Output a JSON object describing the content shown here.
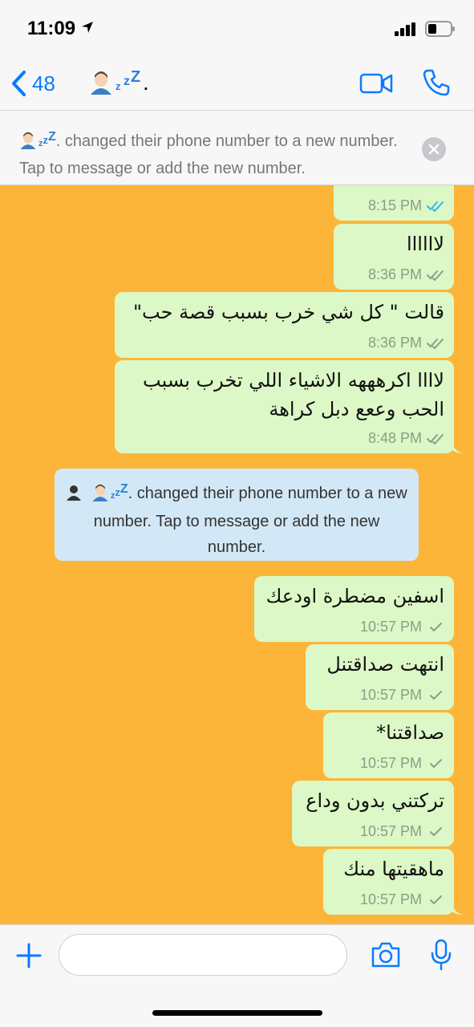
{
  "status_bar": {
    "time": "11:09"
  },
  "header": {
    "back_count": "48",
    "contact_suffix": ".",
    "zzz": [
      "z",
      "z",
      "Z"
    ]
  },
  "banner": {
    "text": ". changed their phone number to a new number. Tap to message or add the new number."
  },
  "messages": [
    {
      "text": "",
      "time": "8:15 PM",
      "status": "read"
    },
    {
      "text": "لاااااا",
      "time": "8:36 PM",
      "status": "delivered"
    },
    {
      "text": "قالت \" كل شي خرب بسبب قصة حب\"",
      "time": "8:36 PM",
      "status": "delivered"
    },
    {
      "line1": "لاااا اكرهههه الاشياء اللي تخرب بسبب",
      "line2": "الحب وععع دبل كراهة",
      "time": "8:48 PM",
      "status": "delivered"
    },
    {
      "text": "اسفين مضطرة اودعك",
      "time": "10:57 PM",
      "status": "sent"
    },
    {
      "text": "انتهت صداقتنل",
      "time": "10:57 PM",
      "status": "sent"
    },
    {
      "text": "صداقتنا*",
      "time": "10:57 PM",
      "status": "sent"
    },
    {
      "text": "تركتني بدون وداع",
      "time": "10:57 PM",
      "status": "sent"
    },
    {
      "text": "ماهقيتها منك",
      "time": "10:57 PM",
      "status": "sent"
    }
  ],
  "system_message": {
    "text": ". changed their phone number to a new number. Tap to message or add the new number."
  },
  "colors": {
    "chat_background": "#fcb538",
    "outgoing_bubble": "#dcf8c6",
    "system_bubble": "#d3e8f6",
    "accent": "#0a7aff",
    "read_tick": "#34b7f1"
  },
  "icons": [
    "location-arrow-icon",
    "signal-icon",
    "battery-icon",
    "back-chevron-icon",
    "video-call-icon",
    "phone-call-icon",
    "close-icon",
    "plus-icon",
    "camera-icon",
    "microphone-icon"
  ]
}
